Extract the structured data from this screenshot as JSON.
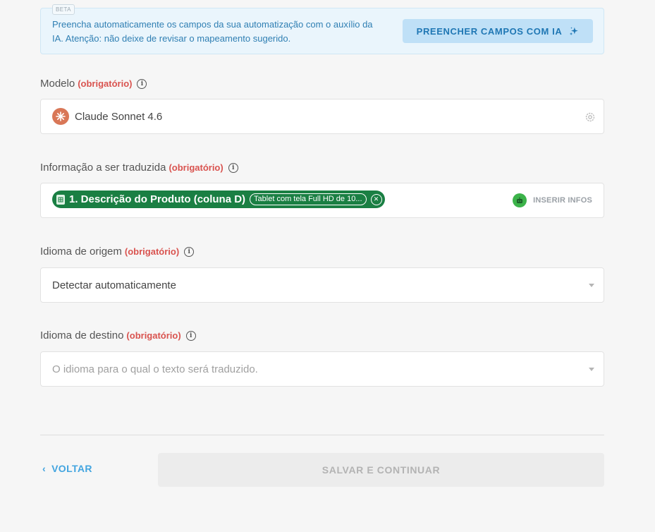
{
  "ai_banner": {
    "badge": "BETA",
    "text": "Preencha automaticamente os campos da sua automatização com o auxílio da IA. Atenção: não deixe de revisar o mapeamento sugerido.",
    "button_label": "PREENCHER CAMPOS COM IA"
  },
  "fields": {
    "model": {
      "label": "Modelo",
      "required": "(obrigatório)",
      "value": "Claude Sonnet 4.6"
    },
    "info": {
      "label": "Informação a ser traduzida",
      "required": "(obrigatório)",
      "chip_label": "1. Descrição do Produto (coluna D)",
      "chip_value": "Tablet com tela Full HD de 10...",
      "insert_label": "INSERIR INFOS"
    },
    "source_lang": {
      "label": "Idioma de origem",
      "required": "(obrigatório)",
      "value": "Detectar automaticamente"
    },
    "target_lang": {
      "label": "Idioma de destino",
      "required": "(obrigatório)",
      "placeholder": "O idioma para o qual o texto será traduzido."
    }
  },
  "footer": {
    "back_label": "VOLTAR",
    "save_label": "SALVAR E CONTINUAR"
  },
  "colors": {
    "accent": "#43a5e0",
    "required": "#d9534f",
    "chip": "#1a7f43",
    "model_icon": "#d97757"
  }
}
